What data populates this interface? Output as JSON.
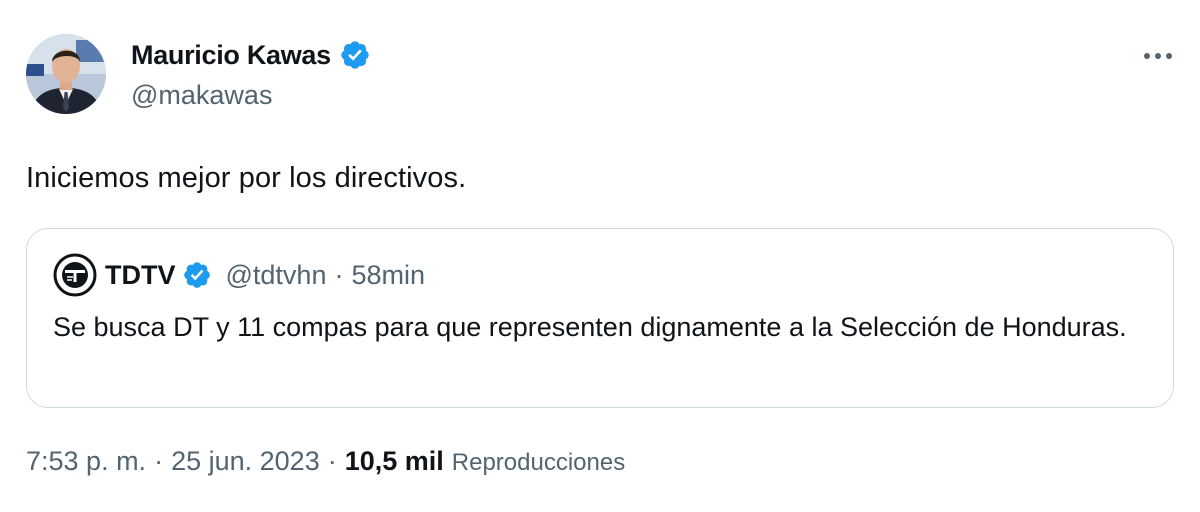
{
  "author": {
    "display_name": "Mauricio Kawas",
    "handle": "@makawas",
    "verified_icon": "verified-badge-icon",
    "avatar_icon": "profile-photo"
  },
  "more_icon": "ellipsis-icon",
  "tweet": {
    "text": "Iniciemos mejor por los directivos."
  },
  "quoted": {
    "display_name": "TDTV",
    "handle": "@tdtvhn",
    "separator": "·",
    "time_ago": "58min",
    "text": "Se busca DT y 11 compas para que representen dignamente a la Selección de Honduras.",
    "avatar_icon": "tdtv-logo-icon"
  },
  "meta": {
    "time": "7:53 p. m.",
    "separator": "·",
    "date": "25 jun. 2023",
    "views_count": "10,5 mil",
    "views_label": "Reproducciones"
  },
  "colors": {
    "verified_blue": "#1d9bf0",
    "text_primary": "#0f1419",
    "text_secondary": "#536471",
    "border": "#cfd9de"
  }
}
